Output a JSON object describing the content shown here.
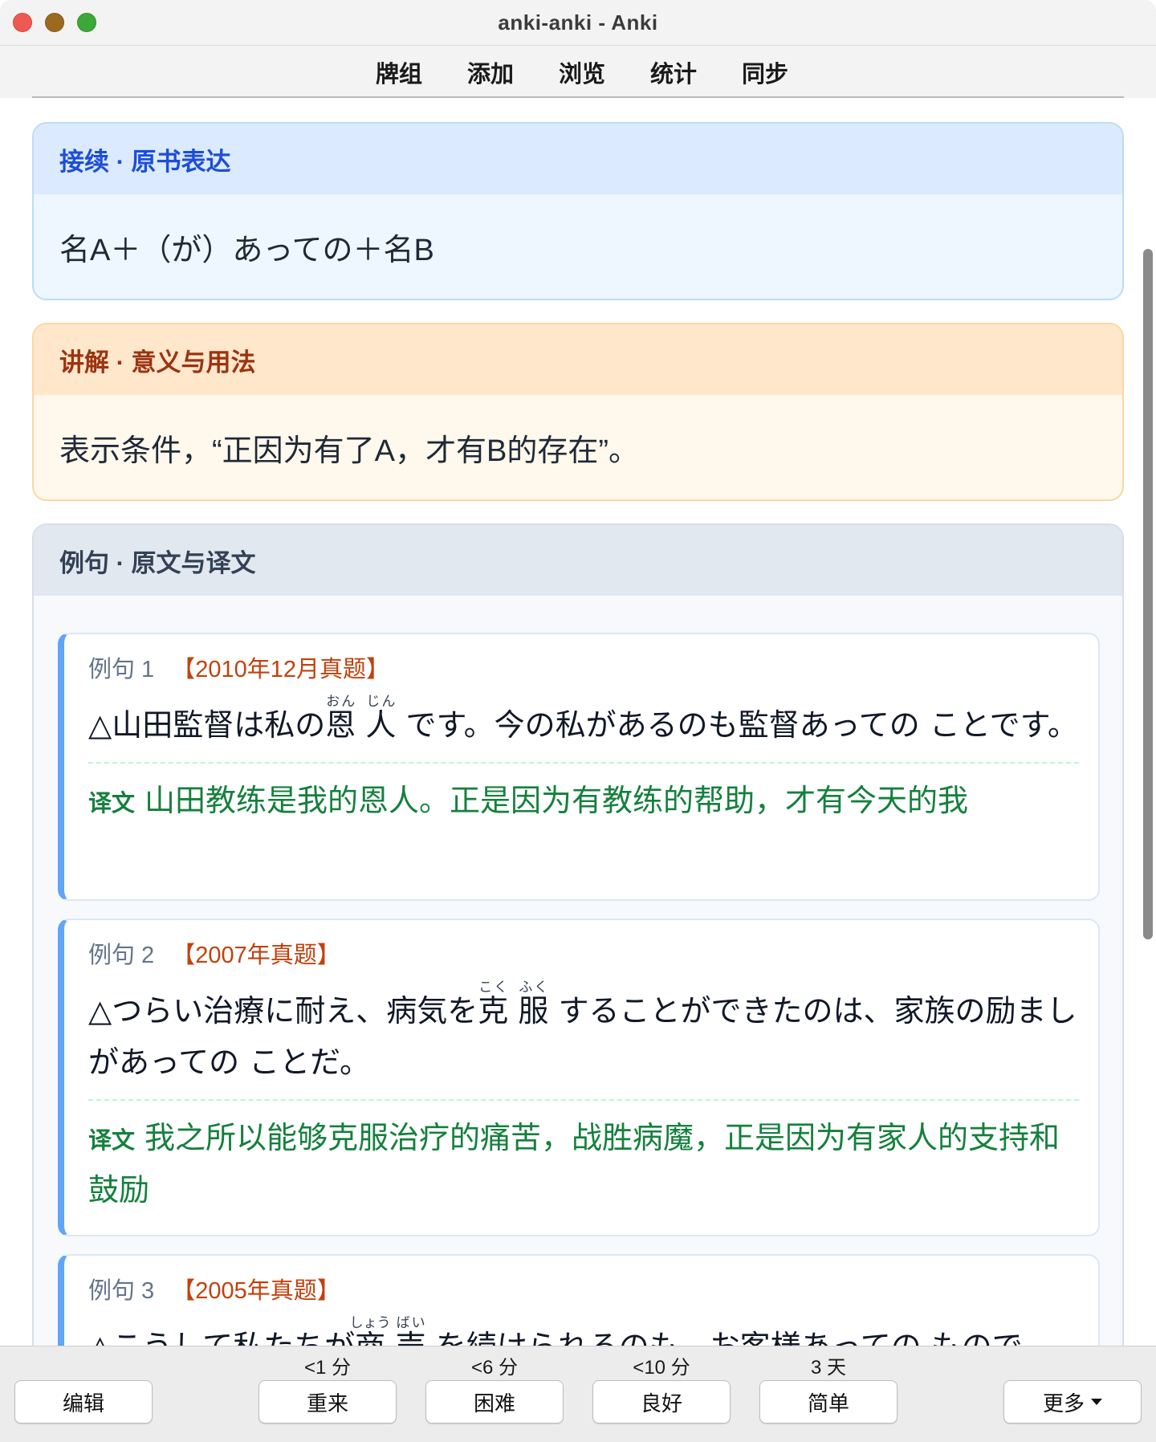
{
  "window": {
    "title": "anki-anki - Anki"
  },
  "toolbar": {
    "items": [
      "牌组",
      "添加",
      "浏览",
      "统计",
      "同步"
    ]
  },
  "sections": {
    "grammar": {
      "title": "接续 · 原书表达",
      "body": "名A＋（が）あっての＋名B"
    },
    "meaning": {
      "title": "讲解 · 意义与用法",
      "body": "表示条件，“正因为有了A，才有B的存在”。"
    },
    "examples": {
      "title": "例句 · 原文与译文"
    }
  },
  "examples": [
    {
      "num": "例句 1",
      "source": "【2010年12月真题】",
      "jp": {
        "pre": "△山田監督は私の",
        "ruby1": "恩",
        "rt1": "おん",
        "ruby2": "人",
        "rt2": "じん",
        "post": " です。今の私があるのも監督あっての ことです。"
      },
      "label": "译文",
      "cn": "山田教练是我的恩人。正是因为有教练的帮助，才有今天的我"
    },
    {
      "num": "例句 2",
      "source": "【2007年真题】",
      "jp": {
        "pre": "△つらい治療に耐え、病気を",
        "ruby1": "克",
        "rt1": "こく",
        "ruby2": "服",
        "rt2": "ふく",
        "post": " することができたのは、家族の励ましがあっての ことだ。"
      },
      "label": "译文",
      "cn": "我之所以能够克服治疗的痛苦，战胜病魔，正是因为有家人的支持和鼓励"
    },
    {
      "num": "例句 3",
      "source": "【2005年真题】",
      "jp": {
        "pre": "△こうして私たちが",
        "ruby1": "商",
        "rt1": "しょう",
        "ruby2": "売",
        "rt2": "ばい",
        "post": " を続けられるのも、お客様あっての ものです。"
      }
    }
  ],
  "answer_bar": {
    "edit": "编辑",
    "more": "更多",
    "buttons": [
      {
        "due": "<1 分",
        "label": "重来"
      },
      {
        "due": "<6 分",
        "label": "困难"
      },
      {
        "due": "<10 分",
        "label": "良好"
      },
      {
        "due": "3 天",
        "label": "简单"
      }
    ]
  }
}
